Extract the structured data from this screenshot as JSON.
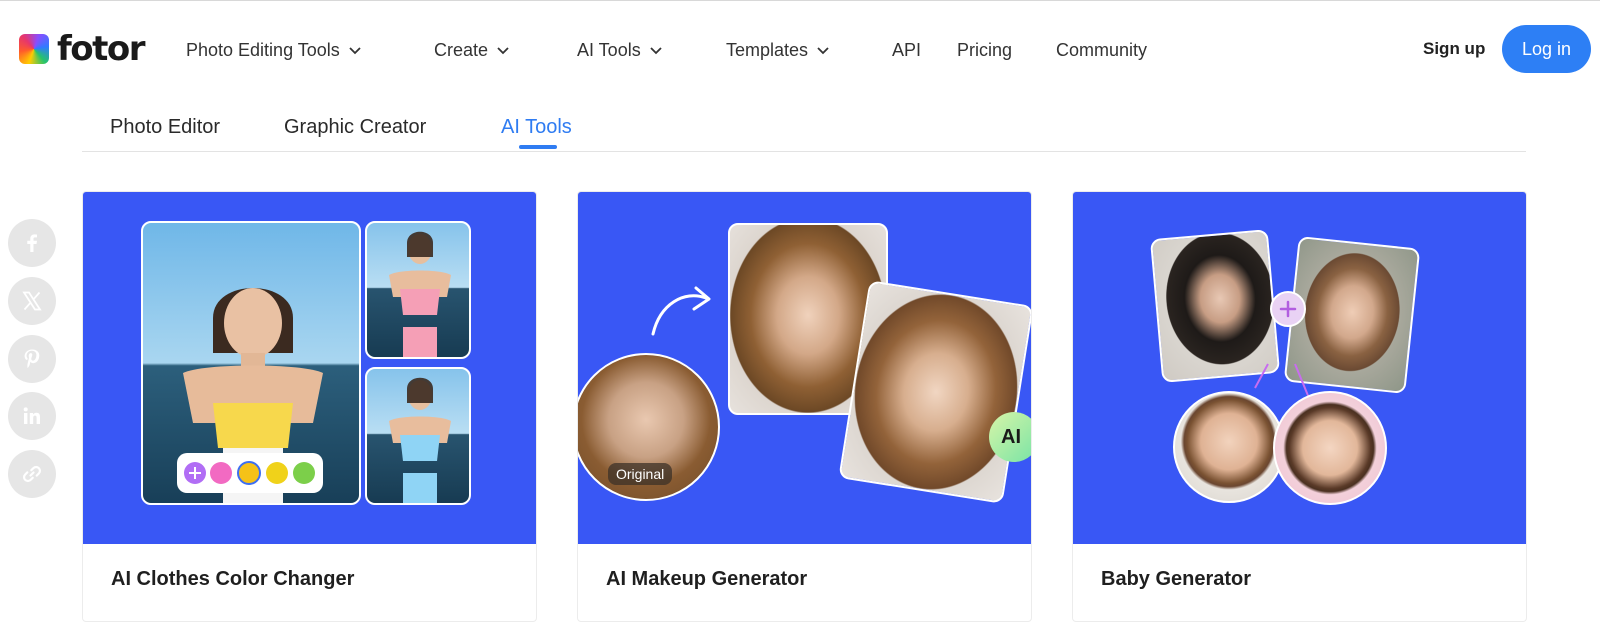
{
  "brand": {
    "name": "fotor"
  },
  "nav": {
    "items": [
      {
        "label": "Photo Editing Tools",
        "dropdown": true
      },
      {
        "label": "Create",
        "dropdown": true
      },
      {
        "label": "AI Tools",
        "dropdown": true
      },
      {
        "label": "Templates",
        "dropdown": true
      },
      {
        "label": "API",
        "dropdown": false
      },
      {
        "label": "Pricing",
        "dropdown": false
      },
      {
        "label": "Community",
        "dropdown": false
      }
    ],
    "signup": "Sign up",
    "login": "Log in"
  },
  "tabs": {
    "items": [
      "Photo Editor",
      "Graphic Creator",
      "AI Tools"
    ],
    "active": "AI Tools"
  },
  "share": [
    "facebook-icon",
    "x-icon",
    "pinterest-icon",
    "linkedin-icon",
    "link-icon"
  ],
  "cards": [
    {
      "title": "AI Clothes Color Changer"
    },
    {
      "title": "AI Makeup Generator",
      "badge_original": "Original",
      "badge_ai": "AI"
    },
    {
      "title": "Baby Generator"
    }
  ],
  "colors": {
    "accent": "#2d7ff5",
    "card_bg": "#3957f5",
    "swatches": [
      "#f26ac2",
      "#f5c218",
      "#f0d21a",
      "#7ccf4a"
    ]
  }
}
